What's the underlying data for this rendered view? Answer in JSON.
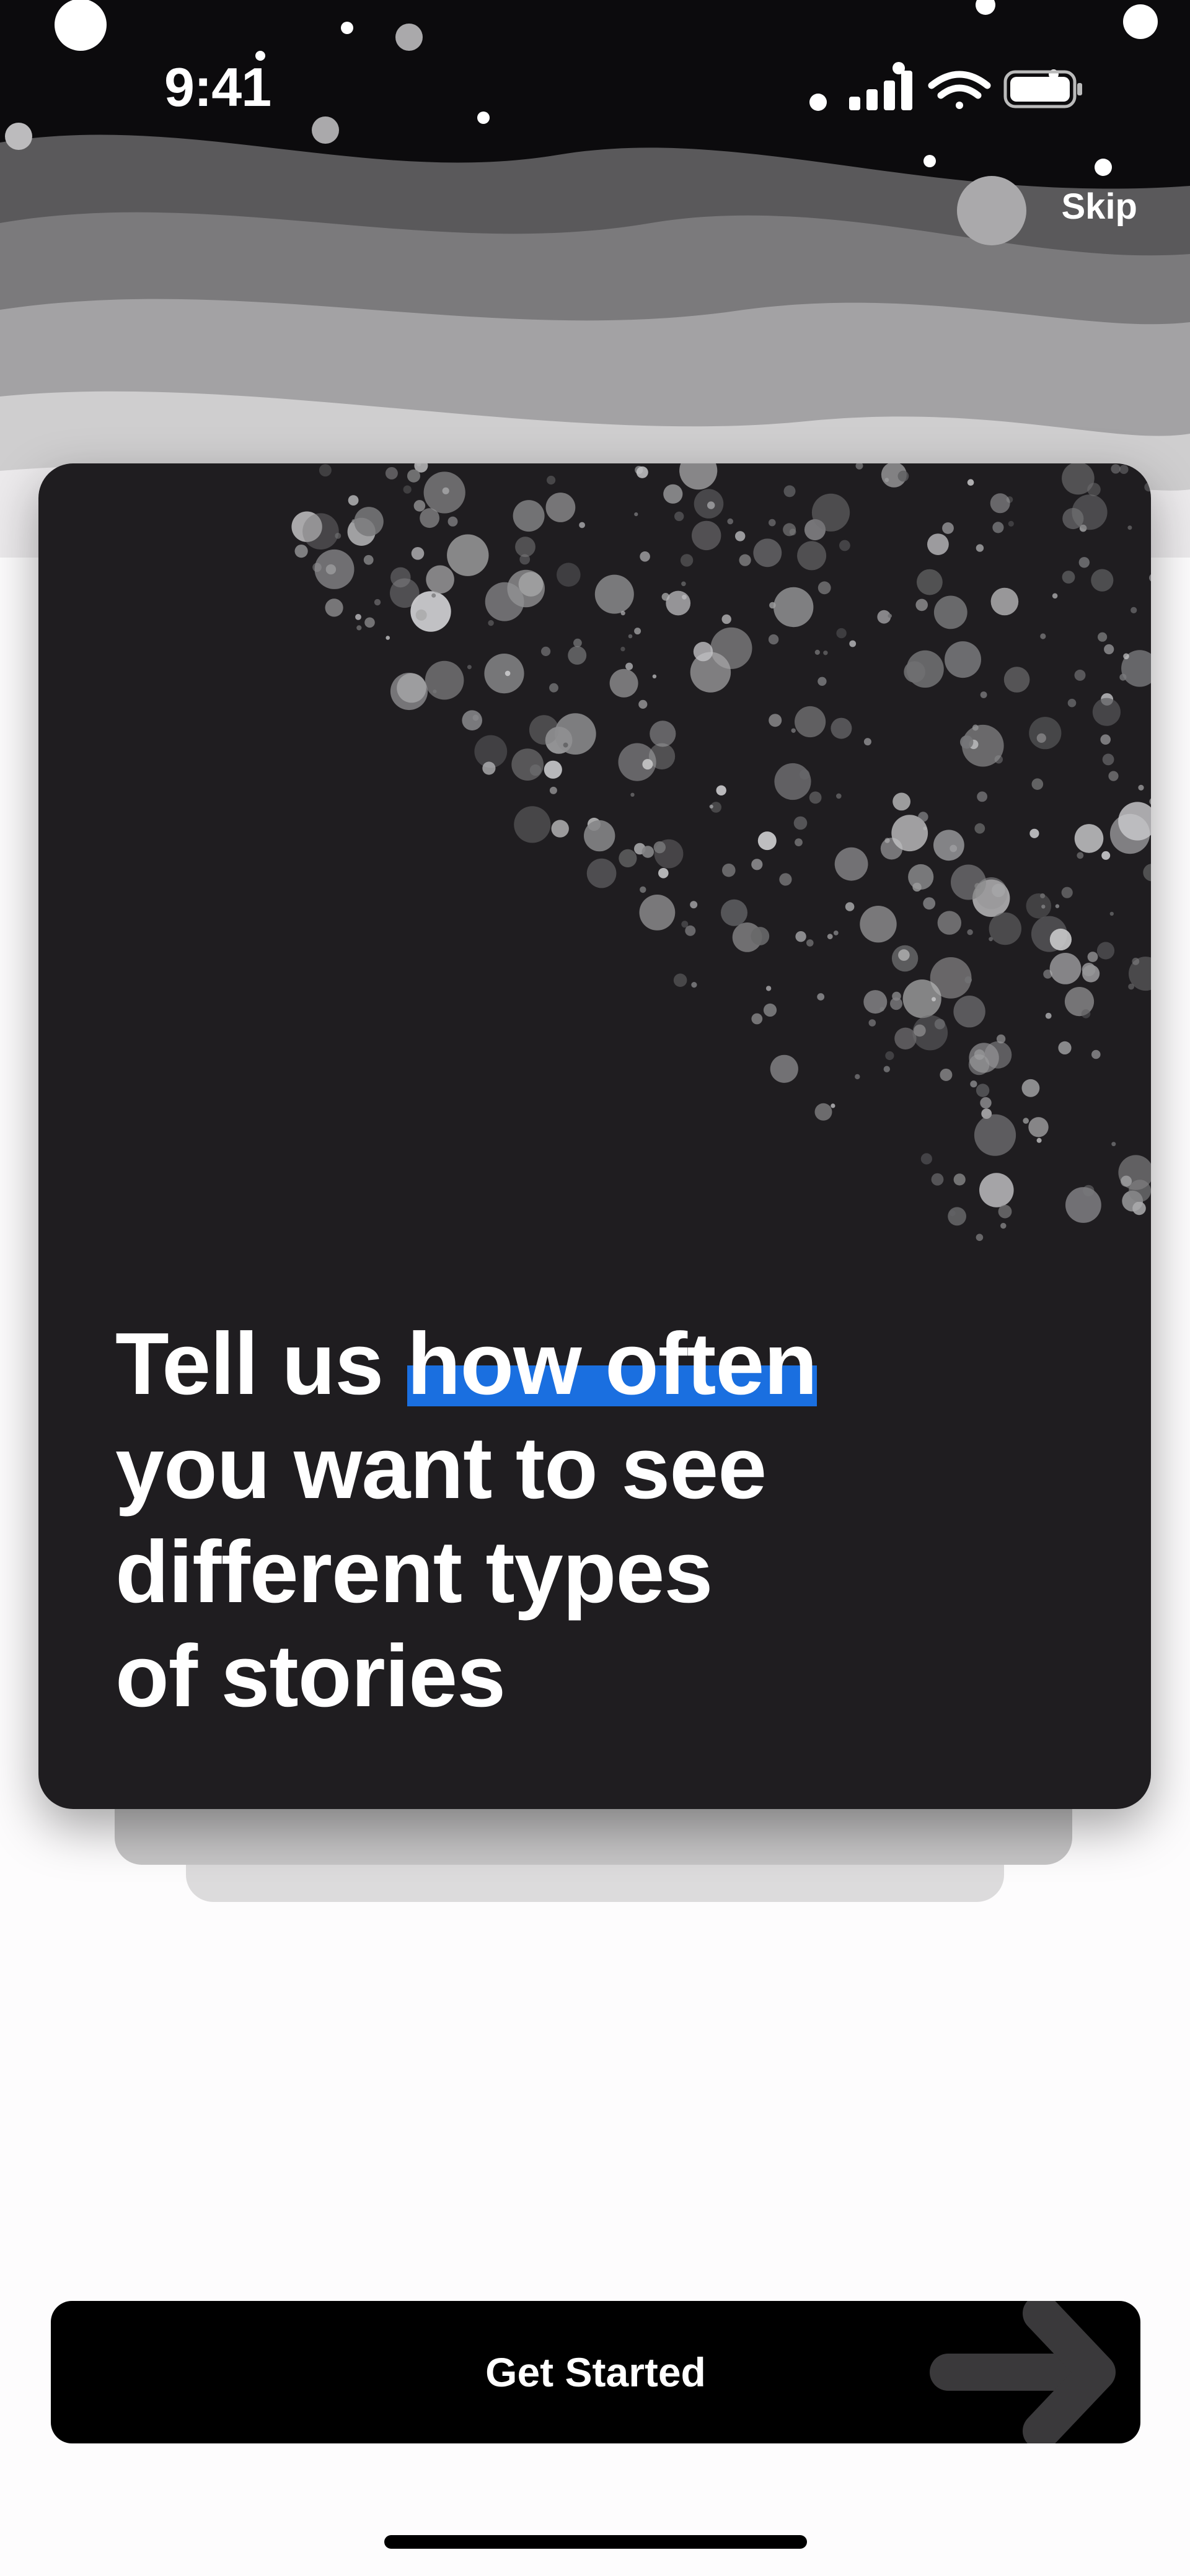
{
  "status_bar": {
    "time": "9:41"
  },
  "header": {
    "skip_label": "Skip"
  },
  "card": {
    "headline_prefix": "Tell us ",
    "headline_highlight": "how often",
    "headline_line2": "you want to see",
    "headline_line3": "different types",
    "headline_line4": "of stories"
  },
  "footer": {
    "cta_label": "Get Started"
  },
  "colors": {
    "highlight": "#1a6fe0",
    "card_background": "#1f1d20",
    "cta_background": "#000000"
  },
  "icons": [
    "cellular-signal-icon",
    "wifi-icon",
    "battery-icon",
    "arrow-right-icon"
  ]
}
